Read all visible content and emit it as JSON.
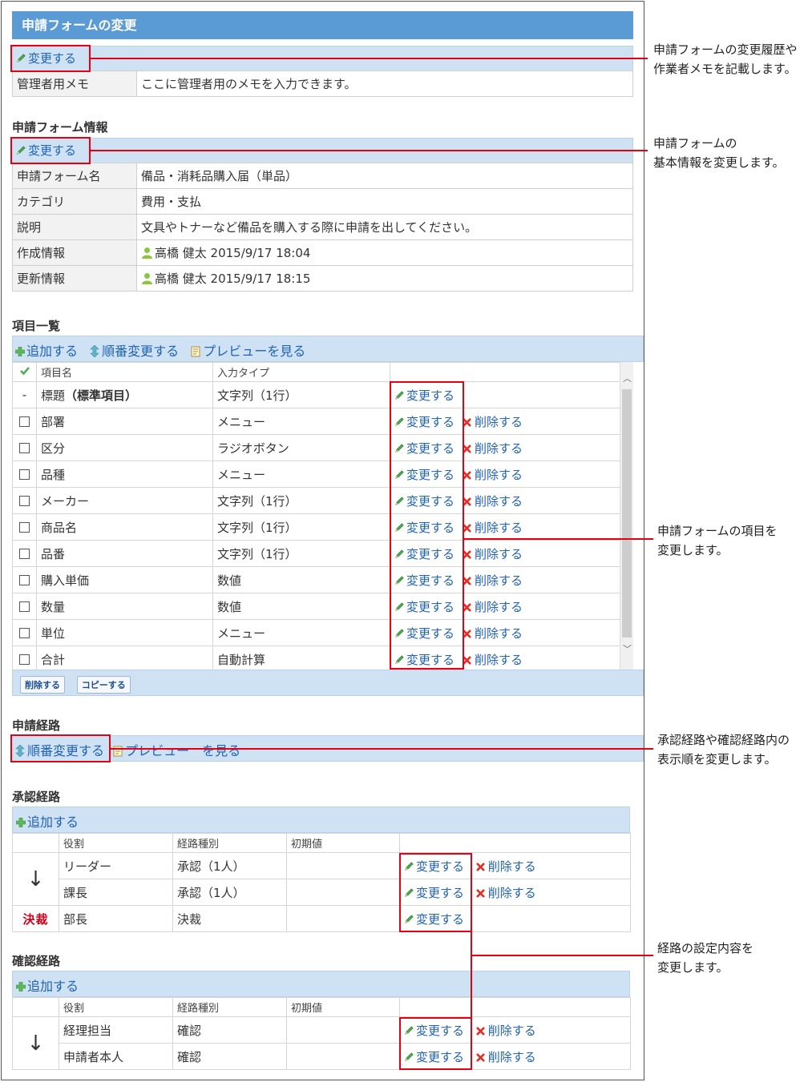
{
  "page_title": "申請フォームの変更",
  "edit_label": "変更する",
  "delete_label": "削除する",
  "add_label": "追加する",
  "reorder_label": "順番変更する",
  "preview_label": "プレビューを見る",
  "preview_label_route": "プレビュー　を見る",
  "memo": {
    "key": "管理者用メモ",
    "value": "ここに管理者用のメモを入力できます。"
  },
  "form_info": {
    "heading": "申請フォーム情報",
    "rows": [
      {
        "key": "申請フォーム名",
        "value": "備品・消耗品購入届（単品）"
      },
      {
        "key": "カテゴリ",
        "value": "費用・支払"
      },
      {
        "key": "説明",
        "value": "文具やトナーなど備品を購入する際に申請を出してください。"
      },
      {
        "key": "作成情報",
        "value": "高橋 健太 2015/9/17 18:04"
      },
      {
        "key": "更新情報",
        "value": "高橋 健太 2015/9/17 18:15"
      }
    ]
  },
  "items": {
    "heading": "項目一覧",
    "col_name": "項目名",
    "col_type": "入力タイプ",
    "rows": [
      {
        "mark": "-",
        "name": "標題",
        "name_suffix": "（標準項目）",
        "type": "文字列（1行）",
        "deletable": false
      },
      {
        "mark": "",
        "name": "部署",
        "name_suffix": "",
        "type": "メニュー",
        "deletable": true
      },
      {
        "mark": "",
        "name": "区分",
        "name_suffix": "",
        "type": "ラジオボタン",
        "deletable": true
      },
      {
        "mark": "",
        "name": "品種",
        "name_suffix": "",
        "type": "メニュー",
        "deletable": true
      },
      {
        "mark": "",
        "name": "メーカー",
        "name_suffix": "",
        "type": "文字列（1行）",
        "deletable": true
      },
      {
        "mark": "",
        "name": "商品名",
        "name_suffix": "",
        "type": "文字列（1行）",
        "deletable": true
      },
      {
        "mark": "",
        "name": "品番",
        "name_suffix": "",
        "type": "文字列（1行）",
        "deletable": true
      },
      {
        "mark": "",
        "name": "購入単価",
        "name_suffix": "",
        "type": "数値",
        "deletable": true
      },
      {
        "mark": "",
        "name": "数量",
        "name_suffix": "",
        "type": "数値",
        "deletable": true
      },
      {
        "mark": "",
        "name": "単位",
        "name_suffix": "",
        "type": "メニュー",
        "deletable": true
      },
      {
        "mark": "",
        "name": "合計",
        "name_suffix": "",
        "type": "自動計算",
        "deletable": true
      }
    ],
    "btn_delete": "削除する",
    "btn_copy": "コピーする"
  },
  "route": {
    "heading": "申請経路"
  },
  "approval": {
    "heading": "承認経路",
    "col_role": "役割",
    "col_kind": "経路種別",
    "col_default": "初期値",
    "rows": [
      {
        "role": "リーダー",
        "kind": "承認（1人）",
        "deletable": true
      },
      {
        "role": "課長",
        "kind": "承認（1人）",
        "deletable": true
      },
      {
        "role": "部長",
        "kind": "決裁",
        "deletable": false
      }
    ],
    "decision_stamp": "決裁"
  },
  "confirm": {
    "heading": "確認経路",
    "col_role": "役割",
    "col_kind": "経路種別",
    "col_default": "初期値",
    "rows": [
      {
        "role": "経理担当",
        "kind": "確認"
      },
      {
        "role": "申請者本人",
        "kind": "確認"
      }
    ]
  },
  "annotations": [
    {
      "lines": [
        "申請フォームの変更履歴や",
        "作業者メモを記載します。"
      ]
    },
    {
      "lines": [
        "申請フォームの",
        "基本情報を変更します。"
      ]
    },
    {
      "lines": [
        "申請フォームの項目を",
        "変更します。"
      ]
    },
    {
      "lines": [
        "承認経路や確認経路内の",
        "表示順を変更します。"
      ]
    },
    {
      "lines": [
        "経路の設定内容を",
        "変更します。"
      ]
    }
  ],
  "colors": {
    "accent_red": "#e60012",
    "title_blue": "#5b9bd5",
    "bar_blue": "#cfe2f3",
    "link_blue": "#1f62b8"
  }
}
